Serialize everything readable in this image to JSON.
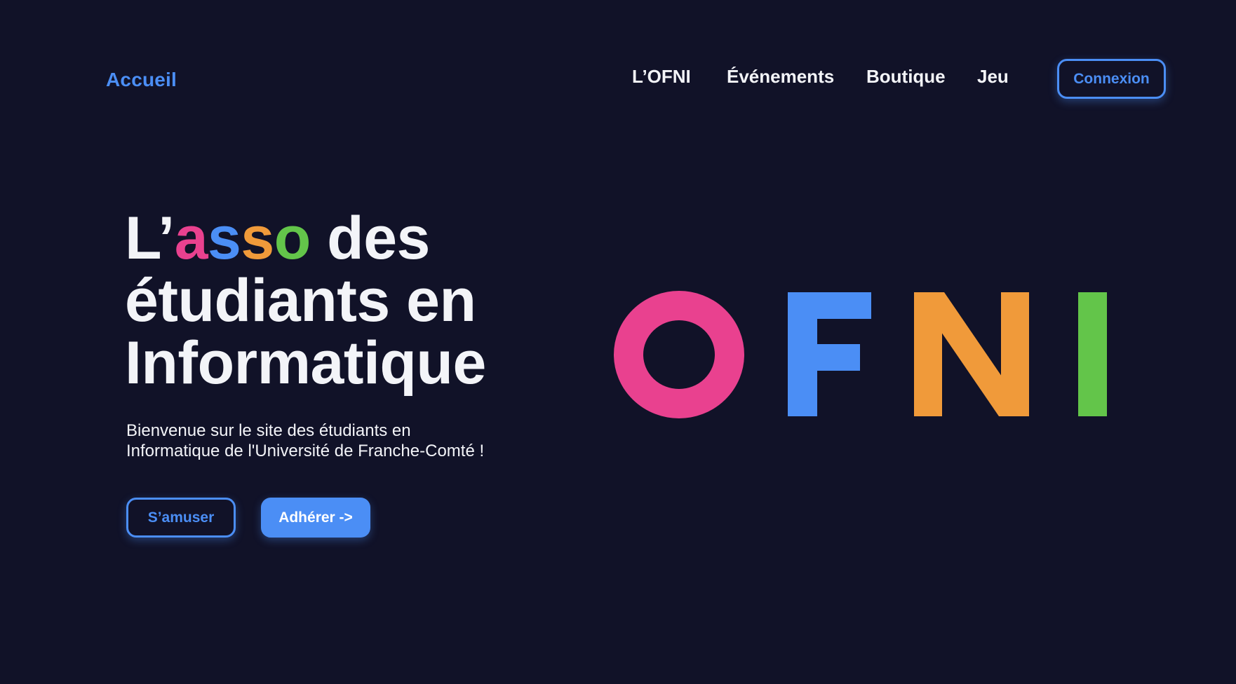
{
  "header": {
    "brand_label": "Accueil",
    "nav": [
      {
        "label": "L’OFNI"
      },
      {
        "label": "Événements"
      },
      {
        "label": "Boutique"
      },
      {
        "label": "Jeu"
      }
    ],
    "login_label": "Connexion"
  },
  "hero": {
    "title": {
      "prefix": "L’",
      "colored_letters": [
        "a",
        "s",
        "s",
        "o"
      ],
      "line1_suffix": " des",
      "line2": "étudiants en",
      "line3": "Informatique"
    },
    "subtitle_line1": "Bienvenue sur le site des étudiants en",
    "subtitle_line2": "Informatique de l'Université de Franche-Comté !",
    "actions": {
      "secondary_label": "S’amuser",
      "primary_label": "Adhérer ->"
    }
  },
  "logo": {
    "letters": [
      "O",
      "F",
      "N",
      "I"
    ]
  },
  "colors": {
    "background": "#111228",
    "accent": "#4b8ef5",
    "pink": "#e9418f",
    "blue": "#4b8ef5",
    "orange": "#f09a3a",
    "green": "#63c54a",
    "text": "#f3f4f8"
  }
}
